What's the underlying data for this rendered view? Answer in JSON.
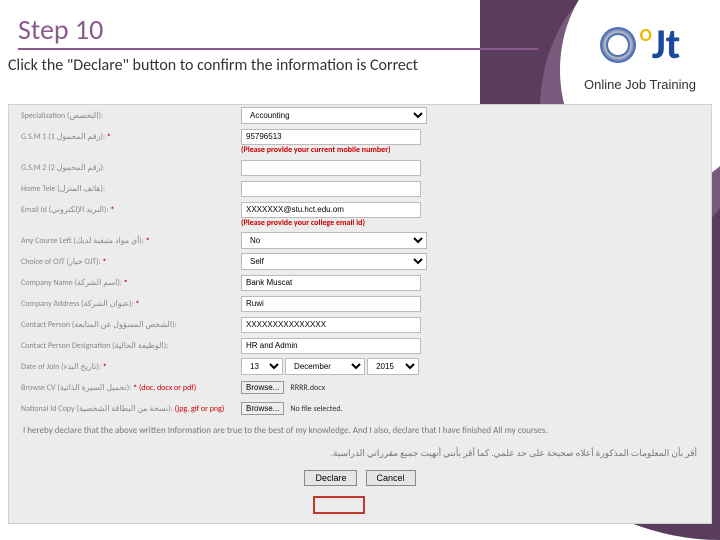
{
  "slide": {
    "title": "Step 10",
    "subtitle": "Click the \"Declare\" button to confirm the information is Correct"
  },
  "brand": {
    "name": "Online Job Training"
  },
  "form": {
    "specialization": {
      "label": "Specialization (التخصص):",
      "value": "Accounting"
    },
    "gsm1": {
      "label": "G.S.M 1 (رقم المحمول 1):",
      "value": "95796513",
      "hint": "(Please provide your current mobile number)"
    },
    "gsm2": {
      "label": "G.S.M 2 (رقم المحمول 2):",
      "value": ""
    },
    "home_tele": {
      "label": "Home Tele (هاتف المنزل):",
      "value": ""
    },
    "email": {
      "label": "Email Id (البريد الإلكتروني):",
      "value": "XXXXXXX@stu.hct.edu.om",
      "hint": "(Please provide your college email id)"
    },
    "course_left": {
      "label": "Any Course Left (أي مواد متبقية لديك):",
      "value": "No"
    },
    "choice": {
      "label": "Choice of OJT (خيار OJT):",
      "value": "Self"
    },
    "company_name": {
      "label": "Company Name (اسم الشركة):",
      "value": "Bank Muscat"
    },
    "company_addr": {
      "label": "Company Address (عنوان الشركة):",
      "value": "Ruwi"
    },
    "contact_person": {
      "label": "Contact Person (الشخص المسؤول عن المتابعة):",
      "value": "XXXXXXXXXXXXXXX"
    },
    "contact_desig": {
      "label": "Contact Person Designation (الوظيفة الحالية):",
      "value": "HR and Admin"
    },
    "doj": {
      "label": "Date of Join (تاريخ البدء):",
      "day": "13",
      "month": "December",
      "year": "2015"
    },
    "cv": {
      "label": "Browse CV (تحميل السيرة الذاتية):",
      "hint": "(doc, docx or pdf)",
      "btn": "Browse...",
      "file": "RRRR.docx"
    },
    "nid": {
      "label": "National Id Copy (نسخة من البطاقة الشخصية):",
      "hint": "(jpg, gif or png)",
      "btn": "Browse...",
      "file": "No file selected."
    },
    "declaration_en": "I hereby declare that the above written Information are true to the best of my knowledge. And I also, declare that I have finished All my courses.",
    "declaration_ar": "أقر بأن المعلومات المذكورة أعلاه صحيحة على حد علمي. كما أقر بأنني أنهيت جميع مقرراتي الدراسية.",
    "buttons": {
      "declare": "Declare",
      "cancel": "Cancel"
    }
  }
}
